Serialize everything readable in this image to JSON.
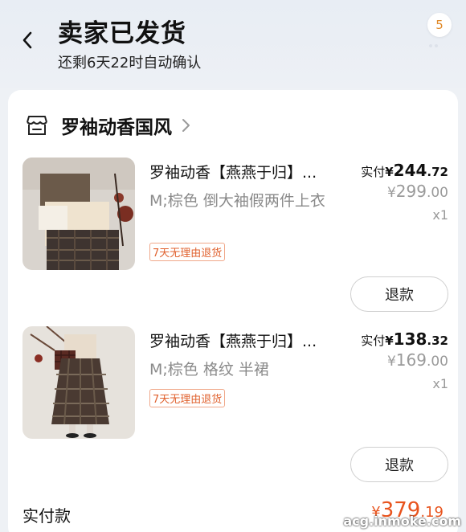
{
  "header": {
    "title": "卖家已发货",
    "subtitle": "还剩6天22时自动确认",
    "badge": "5"
  },
  "shop": {
    "name": "罗袖动香国风"
  },
  "items": [
    {
      "name": "罗袖动香【燕燕于归】...",
      "spec": "M;棕色 倒大袖假两件上衣",
      "tag": "7天无理由退货",
      "paid_label": "实付",
      "paid_currency": "¥",
      "paid_int": "244",
      "paid_dec": ".72",
      "orig_currency": "¥",
      "orig_int": "299",
      "orig_dec": ".00",
      "qty": "x1",
      "refund_label": "退款"
    },
    {
      "name": "罗袖动香【燕燕于归】...",
      "spec": "M;棕色 格纹 半裙",
      "tag": "7天无理由退货",
      "paid_label": "实付",
      "paid_currency": "¥",
      "paid_int": "138",
      "paid_dec": ".32",
      "orig_currency": "¥",
      "orig_int": "169",
      "orig_dec": ".00",
      "qty": "x1",
      "refund_label": "退款"
    }
  ],
  "total": {
    "label": "实付款",
    "currency": "¥",
    "int": "379",
    "dec": ".19"
  },
  "watermark": "acg.inmoke.com",
  "colors": {
    "accent": "#e8541e",
    "tag_border": "#f0a88a",
    "page_bg": "#eef1f5"
  }
}
